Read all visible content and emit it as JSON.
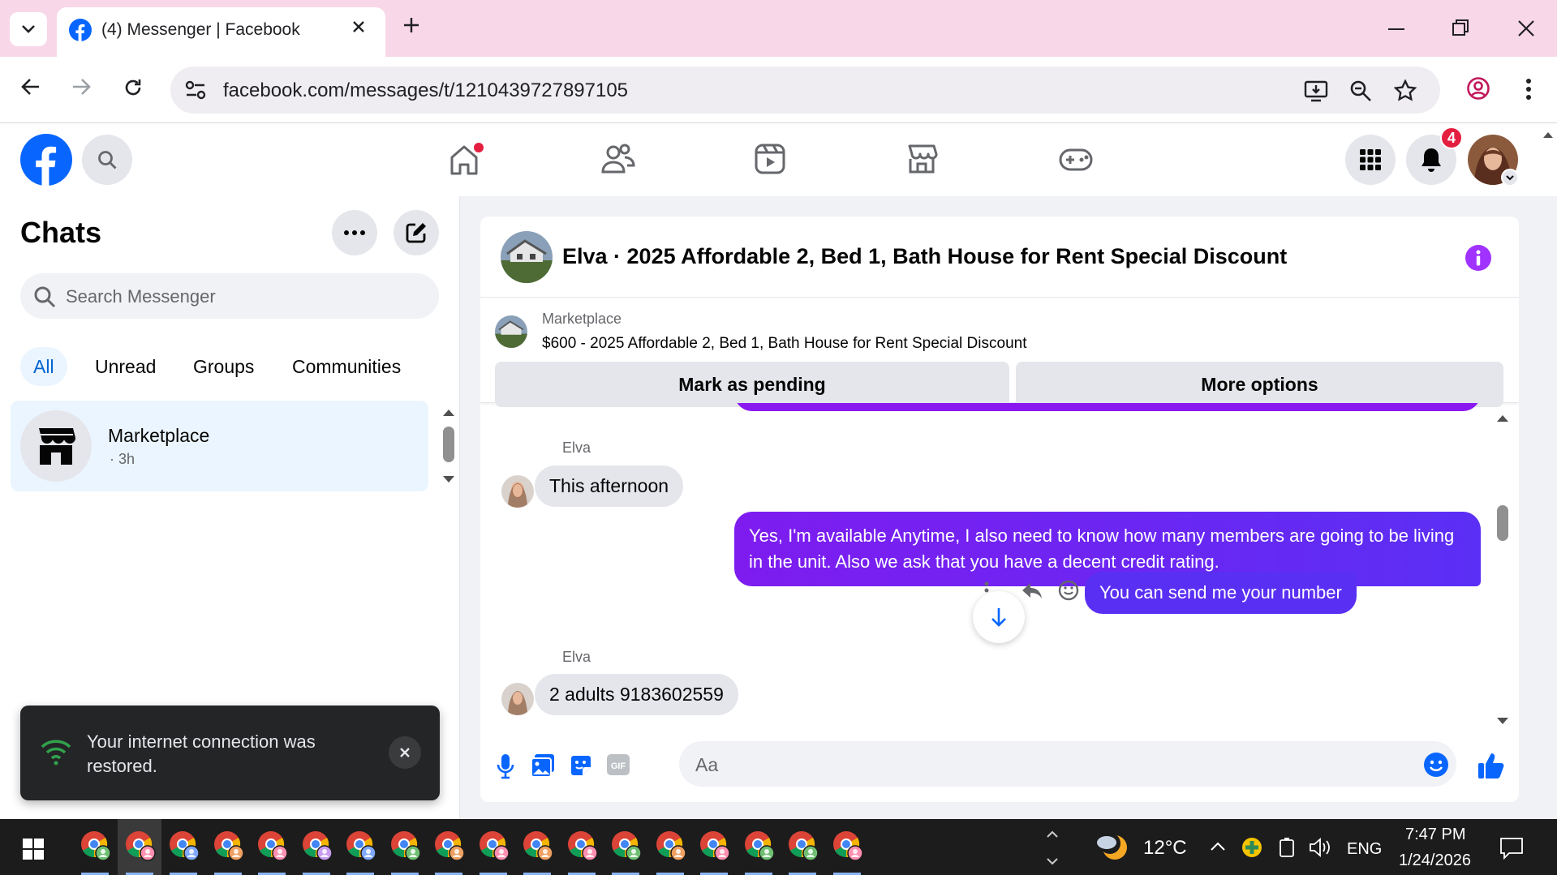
{
  "browser": {
    "tab_title": "(4) Messenger | Facebook",
    "url": "facebook.com/messages/t/1210439727897105"
  },
  "fb_header": {
    "notification_count": "4"
  },
  "sidebar": {
    "title": "Chats",
    "search_placeholder": "Search Messenger",
    "filters": [
      "All",
      "Unread",
      "Groups",
      "Communities"
    ],
    "conversation": {
      "name": "Marketplace",
      "time": "· 3h"
    }
  },
  "toast": {
    "message": "Your internet connection was restored."
  },
  "chat": {
    "title": "Elva · 2025 Affordable 2, Bed 1, Bath House for Rent Special Discount",
    "marketplace_label": "Marketplace",
    "listing": "$600 - 2025 Affordable 2, Bed 1, Bath House for Rent Special Discount",
    "mark_pending": "Mark as pending",
    "more_options": "More options",
    "messages": [
      {
        "sender": "Elva",
        "text": "This afternoon"
      },
      {
        "text": "Yes, I'm available Anytime, I also need to know how many members are going to be living in the unit. Also we ask that you have a decent credit rating."
      },
      {
        "text": "You can send me your number"
      },
      {
        "sender": "Elva",
        "text": "2 adults 9183602559"
      }
    ],
    "composer_placeholder": "Aa"
  },
  "taskbar": {
    "temperature": "12°C",
    "language": "ENG",
    "time": "7:47 PM",
    "date": "1/24/2026"
  },
  "colors": {
    "accent": "#0866ff",
    "tab_bar": "#f8d7e8",
    "outgoing_bubble": "#6f1cf3"
  }
}
